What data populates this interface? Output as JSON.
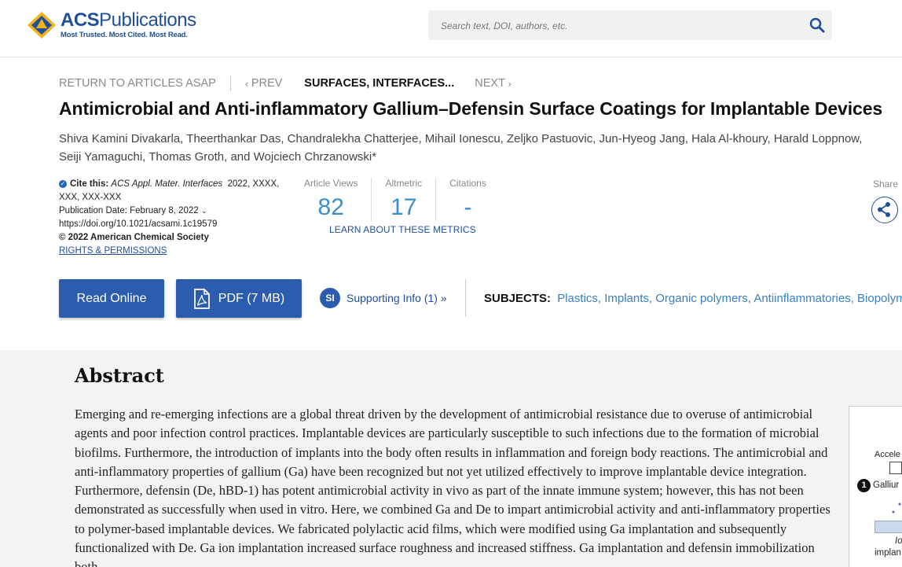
{
  "header": {
    "logo": {
      "main_bold": "ACS",
      "main": "Publications",
      "tagline": "Most Trusted. Most Cited. Most Read."
    },
    "search": {
      "placeholder": "Search text, DOI, authors, etc.",
      "value": ""
    }
  },
  "nav": {
    "return": "RETURN TO ARTICLES ASAP",
    "prev": "PREV",
    "current": "SURFACES, INTERFACES...",
    "next": "NEXT"
  },
  "article": {
    "title": "Antimicrobial and Anti-inflammatory Gallium–Defensin Surface Coatings for Implantable Devices",
    "authors_line1": "Shiva Kamini Divakarla, Theerthankar Das, Chandralekha Chatterjee, Mihail Ionescu, Zeljko Pastuovic, Jun-Hyeog Jang, Hala Al-khoury, Harald Loppnow,",
    "authors_line2": "Seiji Yamaguchi, Thomas Groth, and Wojciech Chrzanowski*"
  },
  "meta": {
    "cite_label": "Cite this:",
    "cite_journal": "ACS Appl. Mater. Interfaces",
    "cite_rest": "2022, XXXX,",
    "cite_line2": "XXX, XXX-XXX",
    "pub_date": "Publication Date: February 8, 2022",
    "doi": "https://doi.org/10.1021/acsami.1c19579",
    "copyright": "© 2022 American Chemical Society",
    "rights": "RIGHTS & PERMISSIONS"
  },
  "metrics": {
    "views_label": "Article Views",
    "views": "82",
    "altmetric_label": "Altmetric",
    "altmetric": "17",
    "citations_label": "Citations",
    "citations": "-",
    "learn": "LEARN ABOUT THESE METRICS"
  },
  "share": {
    "label": "Share"
  },
  "actions": {
    "read_online": "Read Online",
    "pdf": "PDF (7 MB)",
    "si_badge": "SI",
    "supporting_info": "Supporting Info (1) »"
  },
  "subjects": {
    "label": "SUBJECTS:",
    "items": [
      "Plastics,",
      "Implants,",
      "Organic polymers,",
      "Antiinflammatories,",
      "Biopolymers"
    ]
  },
  "abstract": {
    "heading": "Abstract",
    "text": "Emerging and re-emerging infections are a global threat driven by the development of antimicrobial resistance due to overuse of antimicrobial agents and poor infection control practices. Implantable devices are particularly susceptible to such infections due to the formation of microbial biofilms. Furthermore, the introduction of implants into the body often results in inflammation and foreign body reactions. The antimicrobial and anti-inflammatory properties of gallium (Ga) have been recognized but not yet utilized effectively to improve implantable device integration. Furthermore, defensin (De, hBD-1) has potent antimicrobial activity in vivo as part of the innate immune system; however, this has not been demonstrated as successfully when used in vitro. Here, we combined Ga and De to impart antimicrobial activity and anti-inflammatory properties to polymer-based implantable devices. We fabricated polylactic acid films, which were modified using Ga implantation and subsequently functionalized with De. Ga ion implantation increased surface roughness and increased stiffness. Ga implantation and defensin immobilization both",
    "toc": {
      "accel": "Accele",
      "step_num": "1",
      "step_label": "Galliur",
      "ion": "Io",
      "implant": "implan"
    }
  }
}
